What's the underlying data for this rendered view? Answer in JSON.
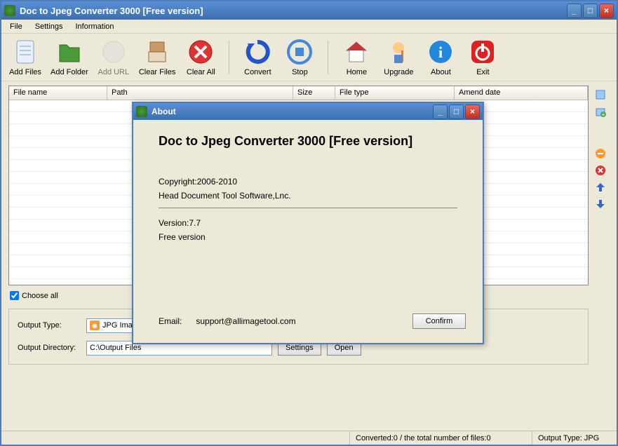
{
  "window": {
    "title": "Doc to Jpeg Converter 3000 [Free version]"
  },
  "menu": {
    "file": "File",
    "settings": "Settings",
    "information": "Information"
  },
  "toolbar": {
    "add_files": "Add Files",
    "add_folder": "Add Folder",
    "add_url": "Add URL",
    "clear_files": "Clear Files",
    "clear_all": "Clear All",
    "convert": "Convert",
    "stop": "Stop",
    "home": "Home",
    "upgrade": "Upgrade",
    "about": "About",
    "exit": "Exit"
  },
  "table": {
    "headers": {
      "file_name": "File name",
      "path": "Path",
      "size": "Size",
      "file_type": "File type",
      "amend_date": "Amend date"
    }
  },
  "choose_all": "Choose all",
  "output": {
    "type_label": "Output Type:",
    "type_value": "JPG Image (*.jpg)",
    "settings_btn": "Settings",
    "dir_label": "Output Directory:",
    "dir_value": "C:\\Output Files",
    "open_btn": "Open"
  },
  "status": {
    "converted": "Converted:0  /  the total number of files:0",
    "output_type": "Output Type: JPG"
  },
  "about": {
    "title": "About",
    "heading": "Doc to Jpeg Converter 3000 [Free version]",
    "copyright": "Copyright:2006-2010",
    "company": "Head Document Tool Software,Lnc.",
    "version": "Version:7.7",
    "edition": "Free version",
    "email_label": "Email:",
    "email_value": "support@allimagetool.com",
    "confirm": "Confirm"
  }
}
